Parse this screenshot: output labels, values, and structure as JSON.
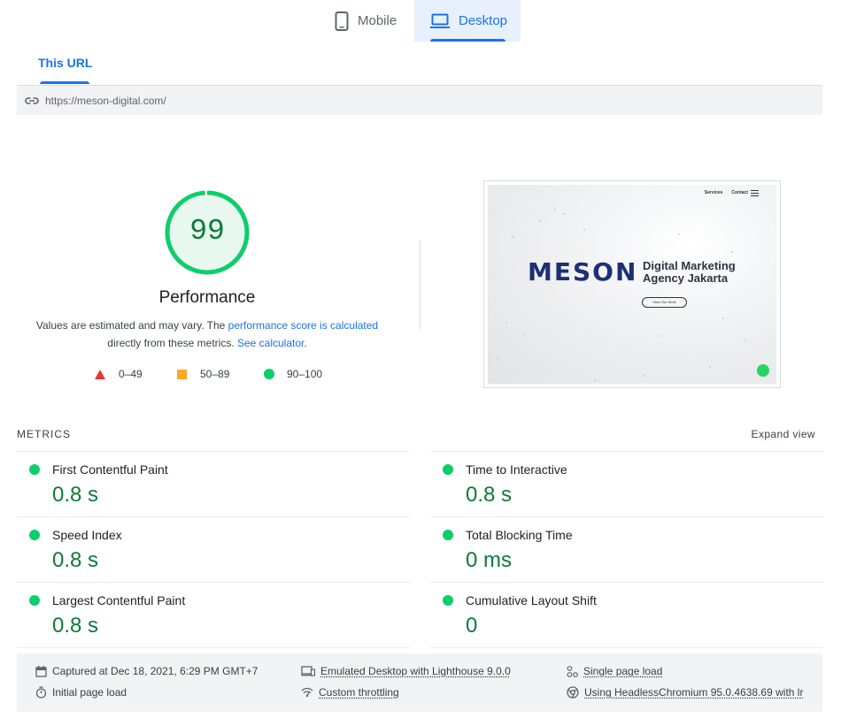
{
  "device_tabs": {
    "mobile_label": "Mobile",
    "desktop_label": "Desktop",
    "active": "Desktop"
  },
  "url_tabs": {
    "this_url_label": "This URL"
  },
  "url": "https://meson-digital.com/",
  "score": {
    "value": "99",
    "percent": 99,
    "category": "Performance",
    "note_prefix": "Values are estimated and may vary. The ",
    "note_link1": "performance score is calculated",
    "note_middle": " directly from these metrics. ",
    "note_link2": "See calculator",
    "note_suffix": ".",
    "color": "#0cce6b"
  },
  "legend": [
    {
      "range": "0–49",
      "shape": "triangle",
      "color": "#e53935"
    },
    {
      "range": "50–89",
      "shape": "square",
      "color": "#ffa726"
    },
    {
      "range": "90–100",
      "shape": "circle",
      "color": "#0cce6b"
    }
  ],
  "thumbnail": {
    "nav_services": "Services",
    "nav_contact": "Contact",
    "logo_text": "MESON",
    "headline": "Digital Marketing Agency Jakarta",
    "cta": "View Our Work"
  },
  "metrics": {
    "title": "METRICS",
    "expand": "Expand view",
    "items": [
      {
        "label": "First Contentful Paint",
        "value": "0.8 s"
      },
      {
        "label": "Time to Interactive",
        "value": "0.8 s"
      },
      {
        "label": "Speed Index",
        "value": "0.8 s"
      },
      {
        "label": "Total Blocking Time",
        "value": "0 ms"
      },
      {
        "label": "Largest Contentful Paint",
        "value": "0.8 s"
      },
      {
        "label": "Cumulative Layout Shift",
        "value": "0"
      }
    ]
  },
  "footer": {
    "captured": "Captured at Dec 18, 2021, 6:29 PM GMT+7",
    "initial_load": "Initial page load",
    "emulated": "Emulated Desktop with Lighthouse 9.0.0",
    "throttling": "Custom throttling",
    "single_load": "Single page load",
    "browser": "Using HeadlessChromium 95.0.4638.69 with lr"
  }
}
